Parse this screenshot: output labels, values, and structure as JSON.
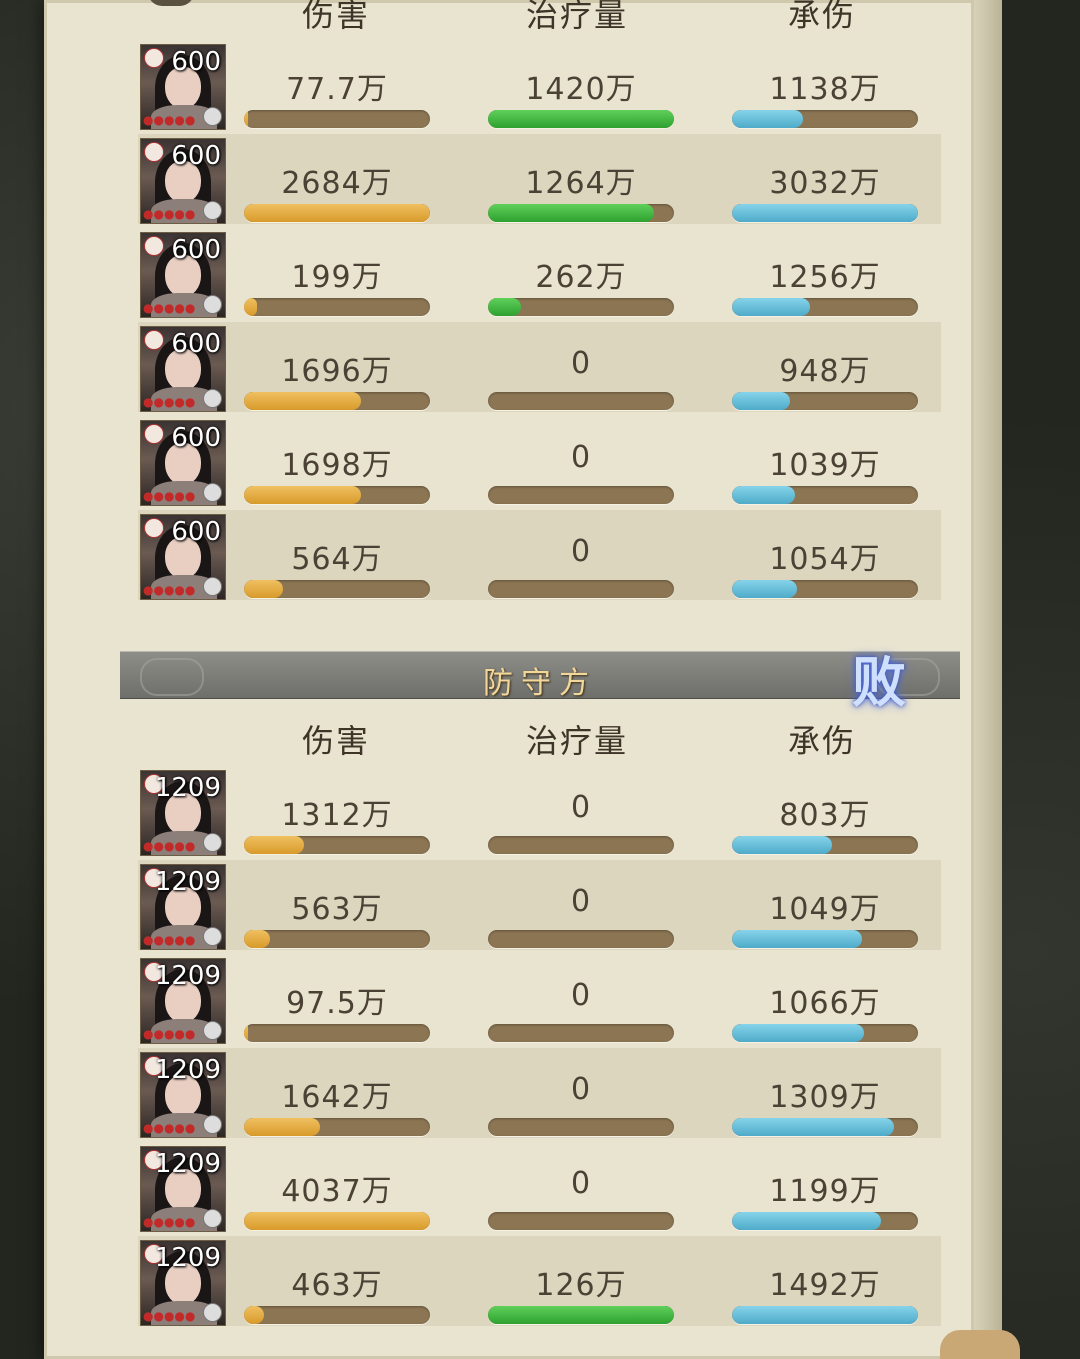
{
  "attacker": {
    "headers": {
      "damage": "伤害",
      "heal": "治疗量",
      "tank": "承伤"
    },
    "rows": [
      {
        "level": "600",
        "damage": "77.7万",
        "damage_pct": 0.02,
        "heal": "1420万",
        "heal_pct": 1.0,
        "tank": "1138万",
        "tank_pct": 0.38
      },
      {
        "level": "600",
        "damage": "2684万",
        "damage_pct": 1.0,
        "heal": "1264万",
        "heal_pct": 0.89,
        "tank": "3032万",
        "tank_pct": 1.0
      },
      {
        "level": "600",
        "damage": "199万",
        "damage_pct": 0.07,
        "heal": "262万",
        "heal_pct": 0.18,
        "tank": "1256万",
        "tank_pct": 0.42
      },
      {
        "level": "600",
        "damage": "1696万",
        "damage_pct": 0.63,
        "heal": "0",
        "heal_pct": 0,
        "tank": "948万",
        "tank_pct": 0.31
      },
      {
        "level": "600",
        "damage": "1698万",
        "damage_pct": 0.63,
        "heal": "0",
        "heal_pct": 0,
        "tank": "1039万",
        "tank_pct": 0.34
      },
      {
        "level": "600",
        "damage": "564万",
        "damage_pct": 0.21,
        "heal": "0",
        "heal_pct": 0,
        "tank": "1054万",
        "tank_pct": 0.35
      }
    ]
  },
  "defender": {
    "banner_title": "防守方",
    "result": "败",
    "headers": {
      "damage": "伤害",
      "heal": "治疗量",
      "tank": "承伤"
    },
    "rows": [
      {
        "level": "1209",
        "damage": "1312万",
        "damage_pct": 0.32,
        "heal": "0",
        "heal_pct": 0,
        "tank": "803万",
        "tank_pct": 0.54
      },
      {
        "level": "1209",
        "damage": "563万",
        "damage_pct": 0.14,
        "heal": "0",
        "heal_pct": 0,
        "tank": "1049万",
        "tank_pct": 0.7
      },
      {
        "level": "1209",
        "damage": "97.5万",
        "damage_pct": 0.02,
        "heal": "0",
        "heal_pct": 0,
        "tank": "1066万",
        "tank_pct": 0.71
      },
      {
        "level": "1209",
        "damage": "1642万",
        "damage_pct": 0.41,
        "heal": "0",
        "heal_pct": 0,
        "tank": "1309万",
        "tank_pct": 0.87
      },
      {
        "level": "1209",
        "damage": "4037万",
        "damage_pct": 1.0,
        "heal": "0",
        "heal_pct": 0,
        "tank": "1199万",
        "tank_pct": 0.8
      },
      {
        "level": "1209",
        "damage": "463万",
        "damage_pct": 0.11,
        "heal": "126万",
        "heal_pct": 1.0,
        "tank": "1492万",
        "tank_pct": 1.0
      }
    ]
  },
  "colors": {
    "damage": "#e0a93a",
    "heal": "#3db83b",
    "tank": "#62c0dc",
    "bar_track": "#8b7553"
  }
}
